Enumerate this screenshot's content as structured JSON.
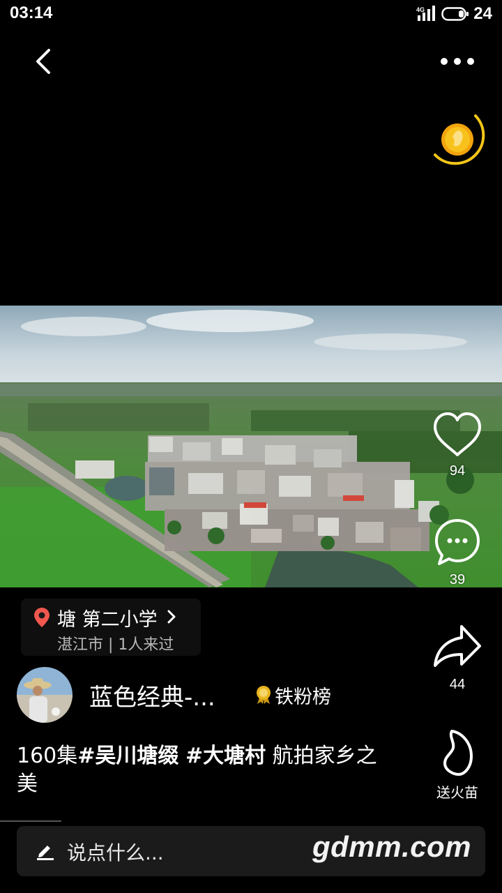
{
  "status_bar": {
    "time": "03:14",
    "network": "4G",
    "battery_level": "24"
  },
  "actions": {
    "like_count": "94",
    "comment_count": "39",
    "share_count": "44",
    "gift_label": "送火苗"
  },
  "location": {
    "name": "塘 第二小学",
    "subtitle": "湛江市 | 1人来过"
  },
  "author": {
    "name": "蓝色经典-...",
    "fans_rank_label": "铁粉榜"
  },
  "caption": {
    "lead": "160集",
    "tag1": "#吴川塘缀",
    "tag2": "#大塘村",
    "text": " 航拍家乡之美"
  },
  "comment_bar": {
    "placeholder": "说点什么...",
    "watermark": "gdmm.com"
  },
  "colors": {
    "background": "#000000",
    "location_pin": "#f0574f",
    "coin_ring": "#f5c518",
    "medal": "#e8b51c"
  },
  "icons": [
    "back-icon",
    "more-icon",
    "coin-icon",
    "heart-icon",
    "comment-icon",
    "share-icon",
    "fire-icon",
    "location-pin-icon",
    "chevron-right-icon",
    "medal-icon",
    "pencil-icon"
  ]
}
